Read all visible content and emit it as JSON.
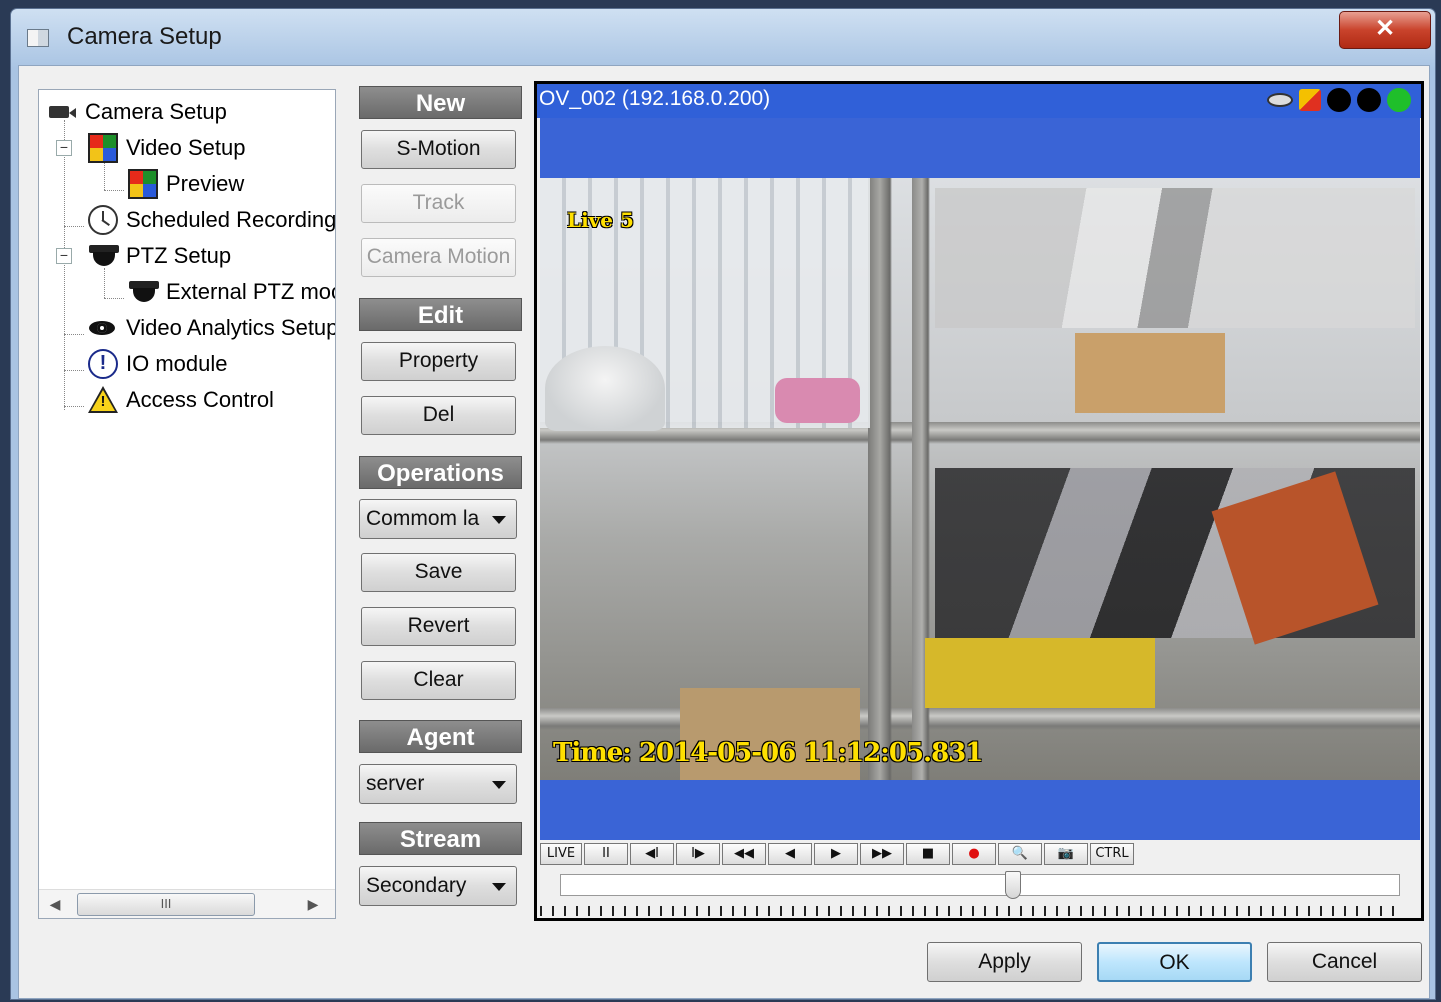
{
  "window": {
    "title": "Camera Setup"
  },
  "tree": {
    "items": [
      {
        "label": "Camera Setup",
        "icon": "camera-icon"
      },
      {
        "label": "Video Setup",
        "icon": "video-grid-icon"
      },
      {
        "label": "Preview",
        "icon": "video-grid-icon"
      },
      {
        "label": "Scheduled Recording",
        "icon": "clock-icon"
      },
      {
        "label": "PTZ Setup",
        "icon": "dome-camera-icon"
      },
      {
        "label": "External PTZ moc",
        "icon": "dome-camera-icon"
      },
      {
        "label": "Video Analytics Setup",
        "icon": "eye-icon"
      },
      {
        "label": "IO module",
        "icon": "io-icon"
      },
      {
        "label": "Access Control",
        "icon": "warning-icon"
      }
    ],
    "expander_minus": "−",
    "scroll": {
      "left": "◀",
      "right": "▶",
      "thumb": "III"
    }
  },
  "sections": {
    "new": {
      "header": "New",
      "buttons": [
        "S-Motion",
        "Track",
        "Camera Motion"
      ]
    },
    "edit": {
      "header": "Edit",
      "buttons": [
        "Property",
        "Del"
      ]
    },
    "operations": {
      "header": "Operations",
      "combo": "Commom la",
      "buttons": [
        "Save",
        "Revert",
        "Clear"
      ]
    },
    "agent": {
      "header": "Agent",
      "combo": "server"
    },
    "stream": {
      "header": "Stream",
      "combo": "Secondary"
    }
  },
  "video": {
    "title": "OV_002 (192.168.0.200)",
    "live_label": "Live 5",
    "timestamp": "Time: 2014-05-06 11:12:05.831",
    "status_icon_colors": [
      "#000000",
      "#000000",
      "#1fbf2a"
    ],
    "controls": [
      "LIVE",
      "II",
      "◀I",
      "I▶",
      "◀◀",
      "◀",
      "▶",
      "▶▶",
      "■",
      "●",
      "🔍",
      "📷",
      "CTRL"
    ],
    "record_color": "#e01010",
    "timeline_position": 0.54
  },
  "footer": {
    "apply": "Apply",
    "ok": "OK",
    "cancel": "Cancel"
  }
}
